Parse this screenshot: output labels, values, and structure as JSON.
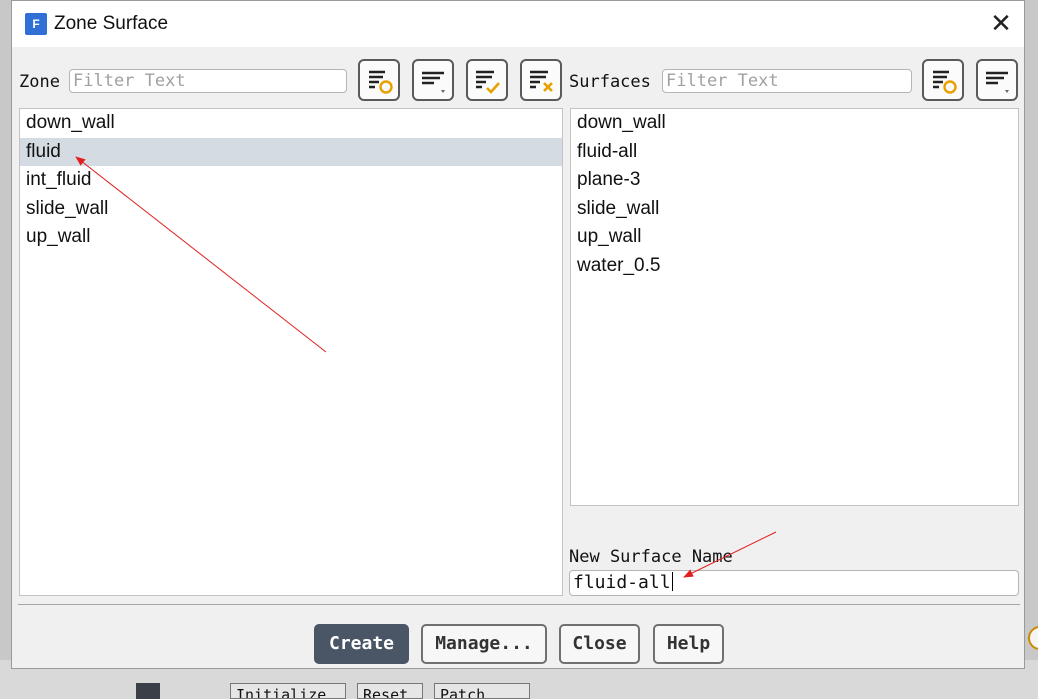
{
  "dialog": {
    "title": "Zone Surface",
    "app_icon_letter": "F",
    "close_symbol": "✕"
  },
  "zone": {
    "label": "Zone",
    "filter_placeholder": "Filter Text",
    "items": [
      "down_wall",
      "fluid",
      "int_fluid",
      "slide_wall",
      "up_wall"
    ],
    "selected": "fluid"
  },
  "surfaces": {
    "label": "Surfaces",
    "filter_placeholder": "Filter Text",
    "items": [
      "down_wall",
      "fluid-all",
      "plane-3",
      "slide_wall",
      "up_wall",
      "water_0.5"
    ]
  },
  "new_surface": {
    "label": "New Surface Name",
    "value": "fluid-all"
  },
  "buttons": {
    "create": "Create",
    "manage": "Manage...",
    "close": "Close",
    "help": "Help"
  },
  "background": {
    "btn_initialize": "Initialize",
    "btn_reset": "Reset",
    "btn_patch": "Patch"
  },
  "colors": {
    "selection": "#d4dbe3",
    "primary_button": "#4a5666",
    "annotation_arrow": "#e02020",
    "app_icon": "#2f6fd6"
  }
}
